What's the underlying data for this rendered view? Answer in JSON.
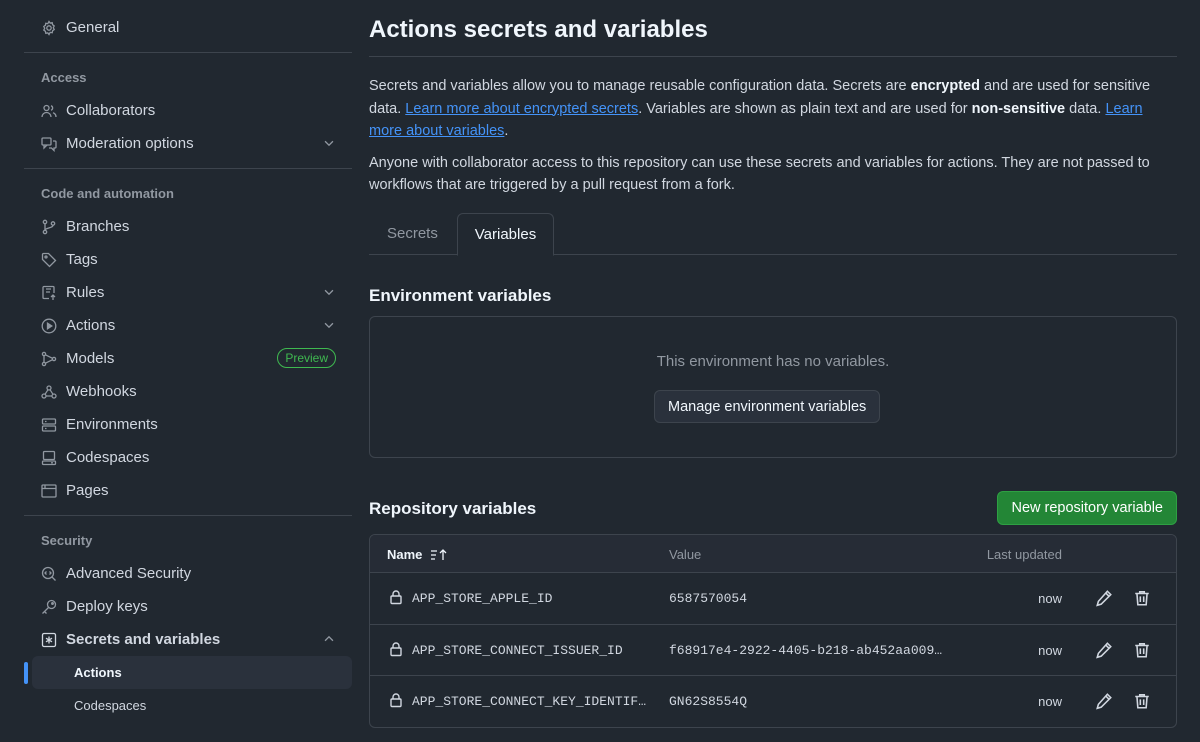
{
  "sidebar": {
    "general": "General",
    "access_label": "Access",
    "collaborators": "Collaborators",
    "moderation": "Moderation options",
    "code_label": "Code and automation",
    "branches": "Branches",
    "tags": "Tags",
    "rules": "Rules",
    "actions": "Actions",
    "models": "Models",
    "preview_badge": "Preview",
    "webhooks": "Webhooks",
    "environments": "Environments",
    "codespaces": "Codespaces",
    "pages": "Pages",
    "security_label": "Security",
    "advanced_security": "Advanced Security",
    "deploy_keys": "Deploy keys",
    "secrets_and_variables": "Secrets and variables",
    "sub_actions": "Actions",
    "sub_codespaces": "Codespaces"
  },
  "main": {
    "title": "Actions secrets and variables",
    "para1": {
      "t1": "Secrets and variables allow you to manage reusable configuration data. Secrets are ",
      "b1": "encrypted",
      "t2": " and are used for sensitive data. ",
      "link1": "Learn more about encrypted secrets",
      "t3": ". Variables are shown as plain text and are used for ",
      "b2": "non-sensitive",
      "t4": " data. ",
      "link2": "Learn more about variables",
      "t5": "."
    },
    "para2": "Anyone with collaborator access to this repository can use these secrets and variables for actions. They are not passed to workflows that are triggered by a pull request from a fork.",
    "tabs": {
      "secrets": "Secrets",
      "variables": "Variables"
    },
    "env": {
      "title": "Environment variables",
      "empty": "This environment has no variables.",
      "manage_button": "Manage environment variables"
    },
    "repo": {
      "title": "Repository variables",
      "new_button": "New repository variable",
      "headers": {
        "name": "Name",
        "value": "Value",
        "updated": "Last updated"
      },
      "rows": [
        {
          "name": "APP_STORE_APPLE_ID",
          "value": "6587570054",
          "updated": "now"
        },
        {
          "name": "APP_STORE_CONNECT_ISSUER_ID",
          "value": "f68917e4-2922-4405-b218-ab452aa009…",
          "updated": "now"
        },
        {
          "name": "APP_STORE_CONNECT_KEY_IDENTIF…",
          "value": "GN62S8554Q",
          "updated": "now"
        }
      ]
    }
  },
  "colors": {
    "accent": "#4493f8",
    "success": "#238636",
    "background": "#212830"
  }
}
